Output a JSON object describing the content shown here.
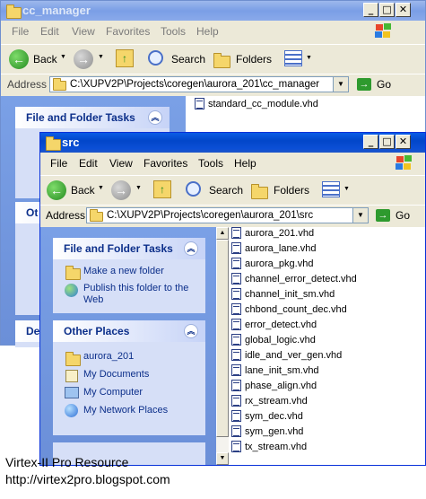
{
  "back_window": {
    "title": "cc_manager",
    "menu": [
      "File",
      "Edit",
      "View",
      "Favorites",
      "Tools",
      "Help"
    ],
    "toolbar": {
      "back": "Back",
      "search": "Search",
      "folders": "Folders"
    },
    "address_label": "Address",
    "address_value": "C:\\XUPV2P\\Projects\\coregen\\aurora_201\\cc_manager",
    "go": "Go",
    "panel_tasks_title": "File and Folder Tasks",
    "panel_other_cut": "Ot",
    "panel_details_cut": "De",
    "files": [
      "standard_cc_module.vhd"
    ]
  },
  "front_window": {
    "title": "src",
    "menu": [
      "File",
      "Edit",
      "View",
      "Favorites",
      "Tools",
      "Help"
    ],
    "toolbar": {
      "back": "Back",
      "search": "Search",
      "folders": "Folders"
    },
    "address_label": "Address",
    "address_value": "C:\\XUPV2P\\Projects\\coregen\\aurora_201\\src",
    "go": "Go",
    "tasks": {
      "title": "File and Folder Tasks",
      "items": [
        "Make a new folder",
        "Publish this folder to the Web"
      ]
    },
    "other_places": {
      "title": "Other Places",
      "items": [
        "aurora_201",
        "My Documents",
        "My Computer",
        "My Network Places"
      ]
    },
    "files": [
      "aurora_201.vhd",
      "aurora_lane.vhd",
      "aurora_pkg.vhd",
      "channel_error_detect.vhd",
      "channel_init_sm.vhd",
      "chbond_count_dec.vhd",
      "error_detect.vhd",
      "global_logic.vhd",
      "idle_and_ver_gen.vhd",
      "lane_init_sm.vhd",
      "phase_align.vhd",
      "rx_stream.vhd",
      "sym_dec.vhd",
      "sym_gen.vhd",
      "tx_stream.vhd"
    ]
  },
  "caption": {
    "line1": "Virtex-II Pro Resource",
    "line2": "http://virtex2pro.blogspot.com"
  },
  "colors": {
    "title_active": "#0246c9",
    "title_inactive": "#7a9ee6",
    "sidebar": "#7aa0e6",
    "link": "#0c2f8a"
  }
}
